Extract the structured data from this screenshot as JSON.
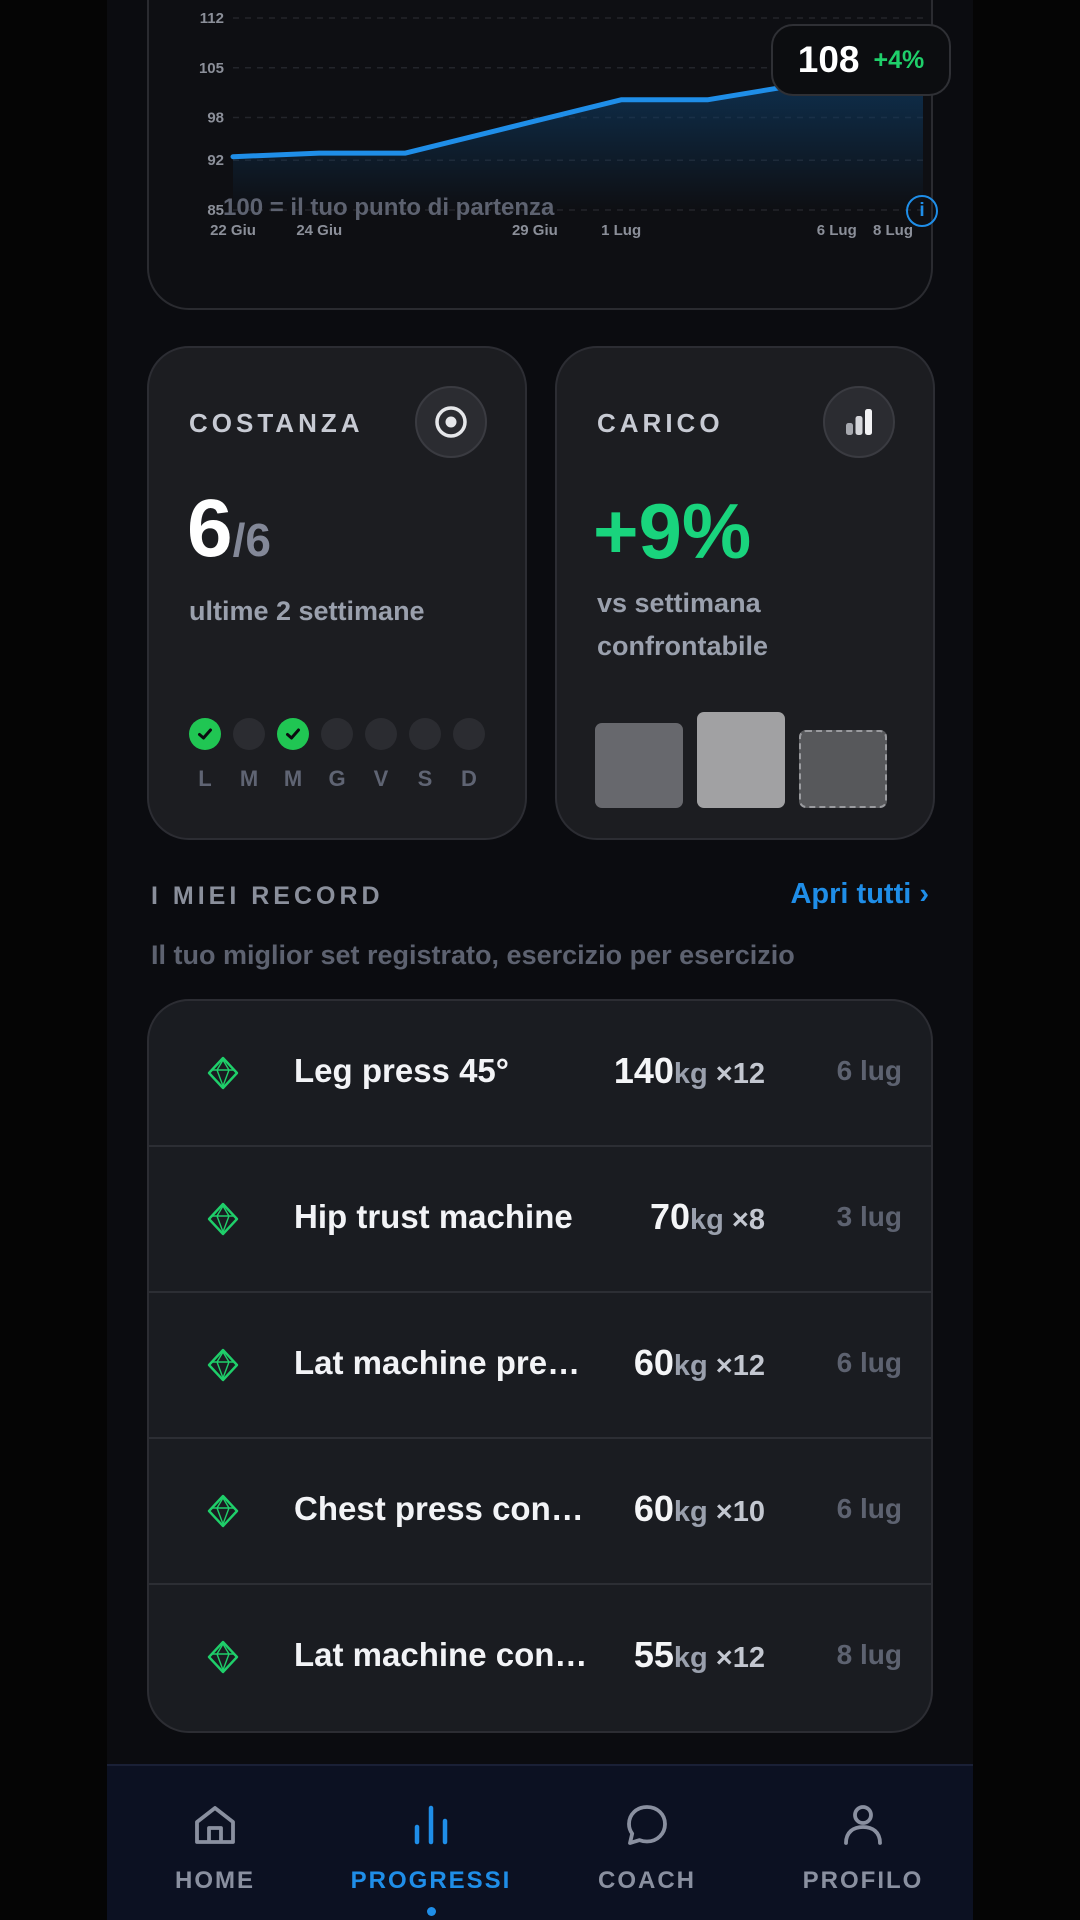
{
  "chart_data": {
    "type": "area",
    "title": "",
    "xlabel": "",
    "ylabel": "",
    "ylim": [
      85,
      112
    ],
    "yticks": [
      "112",
      "105",
      "98",
      "92",
      "85"
    ],
    "xticks": [
      "22 Giu",
      "24 Giu",
      "29 Giu",
      "1 Lug",
      "6 Lug",
      "8 Lug"
    ],
    "series": [
      {
        "x": [
          "22 Giu",
          "24 Giu",
          "26 Giu",
          "29 Giu",
          "1 Lug",
          "3 Lug",
          "6 Lug",
          "8 Lug"
        ],
        "values": [
          92.5,
          93,
          93,
          97.5,
          100.5,
          100.5,
          103.5,
          108
        ]
      }
    ],
    "tooltip": {
      "value": "108",
      "delta": "+4%"
    },
    "footnote": "100 = il tuo punto di partenza",
    "colors": {
      "line": "#1f8ee8",
      "fill": "#0f3b63"
    }
  },
  "info_icon": "i",
  "costanza": {
    "label": "COSTANZA",
    "icon": "target-icon",
    "value": "6",
    "total": "/6",
    "subtitle": "ultime 2 settimane",
    "days": [
      {
        "label": "L",
        "done": true
      },
      {
        "label": "M",
        "done": false
      },
      {
        "label": "M",
        "done": true
      },
      {
        "label": "G",
        "done": false
      },
      {
        "label": "V",
        "done": false
      },
      {
        "label": "S",
        "done": false
      },
      {
        "label": "D",
        "done": false
      }
    ]
  },
  "carico": {
    "label": "CARICO",
    "icon": "bar-chart-icon",
    "value": "+9%",
    "subtitle": "vs settimana confrontabile",
    "bars": [
      {
        "level": 0.89,
        "color": "#67686d",
        "dashed": false
      },
      {
        "level": 1.0,
        "color": "#a1a1a3",
        "dashed": false
      },
      {
        "level": 0.81,
        "color": "#57585b",
        "dashed": true
      }
    ]
  },
  "records": {
    "title": "I MIEI RECORD",
    "link": "Apri tutti ›",
    "description": "Il tuo miglior set registrato, esercizio per esercizio",
    "unit": "kg",
    "items": [
      {
        "name": "Leg press 45°",
        "weight": "140",
        "reps": " ×12",
        "date": "6 lug"
      },
      {
        "name": "Hip trust machine",
        "weight": "70",
        "reps": " ×8",
        "date": "3 lug"
      },
      {
        "name": "Lat machine pre…",
        "weight": "60",
        "reps": " ×12",
        "date": "6 lug"
      },
      {
        "name": "Chest press con…",
        "weight": "60",
        "reps": " ×10",
        "date": "6 lug"
      },
      {
        "name": "Lat machine con…",
        "weight": "55",
        "reps": " ×12",
        "date": "8 lug"
      }
    ]
  },
  "nav": {
    "items": [
      {
        "label": "HOME",
        "icon": "home-icon",
        "active": false
      },
      {
        "label": "PROGRESSI",
        "icon": "stats-icon",
        "active": true
      },
      {
        "label": "COACH",
        "icon": "chat-icon",
        "active": false
      },
      {
        "label": "PROFILO",
        "icon": "user-icon",
        "active": false
      }
    ]
  }
}
